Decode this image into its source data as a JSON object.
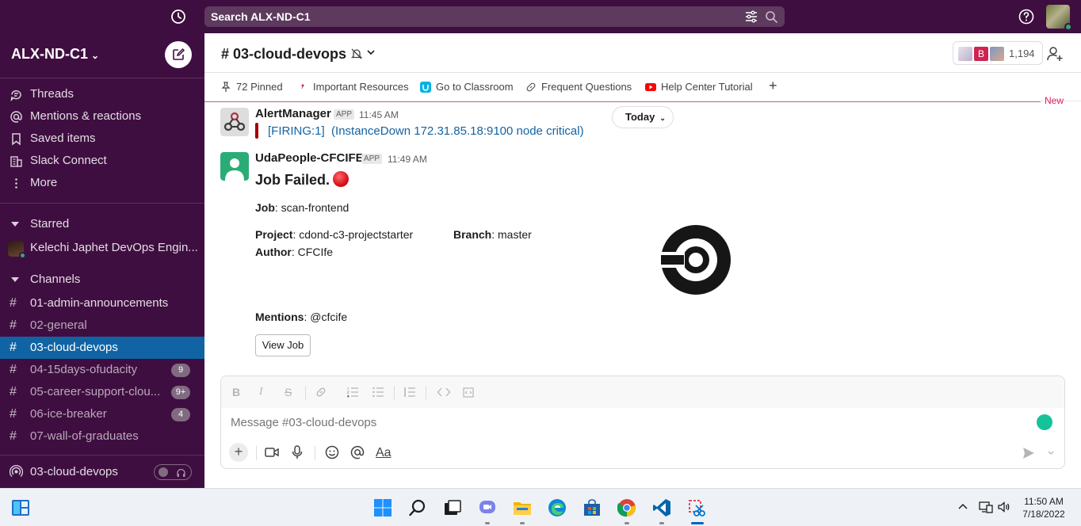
{
  "topbar": {
    "search_text": "Search ALX-ND-C1"
  },
  "sidebar": {
    "workspace_name": "ALX-ND-C1",
    "nav": [
      {
        "label": "Threads"
      },
      {
        "label": "Mentions & reactions"
      },
      {
        "label": "Saved items"
      },
      {
        "label": "Slack Connect"
      },
      {
        "label": "More"
      }
    ],
    "starred_label": "Starred",
    "starred_items": [
      {
        "label": "Kelechi Japhet DevOps Engin..."
      }
    ],
    "channels_label": "Channels",
    "channels": [
      {
        "name": "01-admin-announcements",
        "badge": ""
      },
      {
        "name": "02-general",
        "badge": ""
      },
      {
        "name": "03-cloud-devops",
        "badge": ""
      },
      {
        "name": "04-15days-ofudacity",
        "badge": "9"
      },
      {
        "name": "05-career-support-clou...",
        "badge": "9+"
      },
      {
        "name": "06-ice-breaker",
        "badge": "4"
      },
      {
        "name": "07-wall-of-graduates",
        "badge": ""
      }
    ],
    "huddle_channel": "03-cloud-devops"
  },
  "header": {
    "channel_title": "03-cloud-devops",
    "member_avatar_letter": "B",
    "member_count": "1,194"
  },
  "bookmarks": [
    {
      "label": "72 Pinned"
    },
    {
      "label": "Important Resources"
    },
    {
      "label": "Go to Classroom"
    },
    {
      "label": "Frequent Questions"
    },
    {
      "label": "Help Center Tutorial"
    }
  ],
  "new_label": "New",
  "today_label": "Today",
  "messages": [
    {
      "sender": "AlertManager",
      "tag": "APP",
      "time": "11:45 AM",
      "firing": "[FIRING:1]",
      "alert_text": "(InstanceDown 172.31.85.18:9100 node critical)"
    },
    {
      "sender": "UdaPeople-CFCIFE",
      "tag": "APP",
      "time": "11:49 AM",
      "title": "Job Failed.",
      "job_label": "Job",
      "job_value": ": scan-frontend",
      "project_label": "Project",
      "project_value": ": cdond-c3-projectstarter",
      "branch_label": "Branch",
      "branch_value": ": master",
      "author_label": "Author",
      "author_value": ": CFCIfe",
      "mentions_label": "Mentions",
      "mentions_value": ": @cfcife",
      "button_label": "View Job"
    }
  ],
  "composer": {
    "placeholder": "Message #03-cloud-devops",
    "aa_label": "Aa"
  },
  "taskbar": {
    "time": "11:50 AM",
    "date": "7/18/2022"
  },
  "colors": {
    "sidebar_bg": "#3f0e40",
    "active_channel": "#1164a3",
    "link": "#1264a3",
    "alert_bar": "#a30200",
    "new_line": "#e01e5a"
  }
}
